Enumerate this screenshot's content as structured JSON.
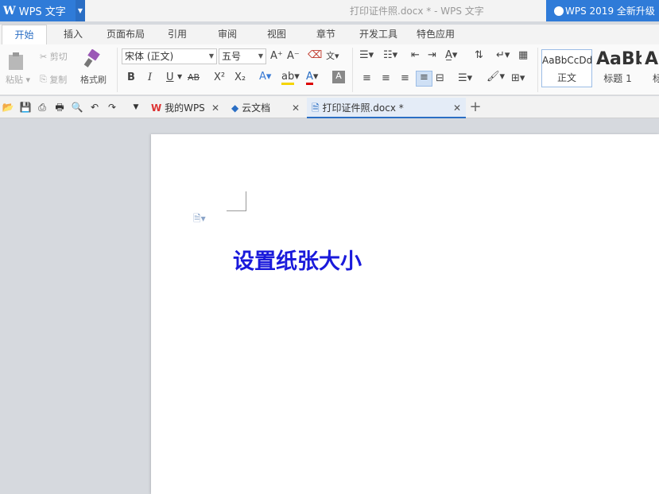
{
  "titlebar": {
    "app_name": "WPS 文字",
    "document_title": "打印证件照.docx * - WPS 文字",
    "upgrade_label": "WPS 2019 全新升级"
  },
  "menu": {
    "tabs": [
      "开始",
      "插入",
      "页面布局",
      "引用",
      "审阅",
      "视图",
      "章节",
      "开发工具",
      "特色应用"
    ],
    "active": "开始"
  },
  "ribbon": {
    "paste": "粘贴",
    "cut": "剪切",
    "copy": "复制",
    "format_painter": "格式刷",
    "font_name": "宋体 (正文)",
    "font_size": "五号",
    "bold": "B",
    "italic": "I",
    "underline": "U",
    "strikethrough": "AB",
    "superscript": "X²",
    "subscript": "X₂",
    "styles": [
      {
        "sample": "AaBbCcDd",
        "label": "正文"
      },
      {
        "sample": "AaBb",
        "label": "标题 1"
      },
      {
        "sample": "A",
        "label": "标"
      }
    ]
  },
  "doc_tabs": [
    {
      "label": "我的WPS",
      "icon": "wps-logo-icon"
    },
    {
      "label": "云文档",
      "icon": "cloud-cube-icon"
    },
    {
      "label": "打印证件照.docx *",
      "icon": "document-icon",
      "active": true
    }
  ],
  "document": {
    "heading": "设置纸张大小",
    "heading_color": "#1a1adb"
  },
  "colors": {
    "accent": "#2f7bd8"
  }
}
